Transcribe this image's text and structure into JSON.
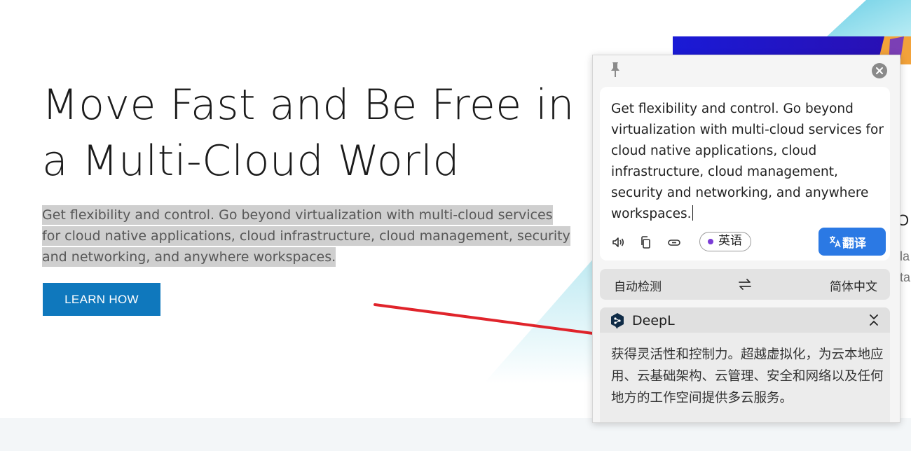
{
  "hero": {
    "title": "Move Fast and Be Free in a Multi-Cloud World",
    "description": "Get flexibility and control. Go beyond virtualization with multi-cloud services for cloud native applications, cloud infrastructure, cloud management, security and networking, and anywhere workspaces.",
    "cta_label": "LEARN HOW"
  },
  "translator": {
    "source_text": "Get flexibility and control. Go beyond virtualization with multi-cloud services for cloud native applications, cloud infrastructure, cloud management, security and networking, and anywhere workspaces.",
    "detected_language": "英语",
    "translate_label": "翻译",
    "from_language": "自动检测",
    "to_language": "简体中文",
    "engine": {
      "name": "DeepL",
      "result": "获得灵活性和控制力。超越虚拟化，为云本地应用、云基础架构、云管理、安全和网络以及任何地方的工作空间提供多云服务。"
    }
  },
  "colors": {
    "cta_bg": "#0f78bd",
    "translate_btn_bg": "#2b79e4",
    "arrow": "#e0242b",
    "language_dot": "#7a3bd6"
  },
  "icons": [
    "pin-icon",
    "close-icon",
    "speaker-icon",
    "copy-icon",
    "link-icon",
    "translate-icon",
    "swap-icon",
    "deepl-logo-icon",
    "collapse-icon"
  ]
}
